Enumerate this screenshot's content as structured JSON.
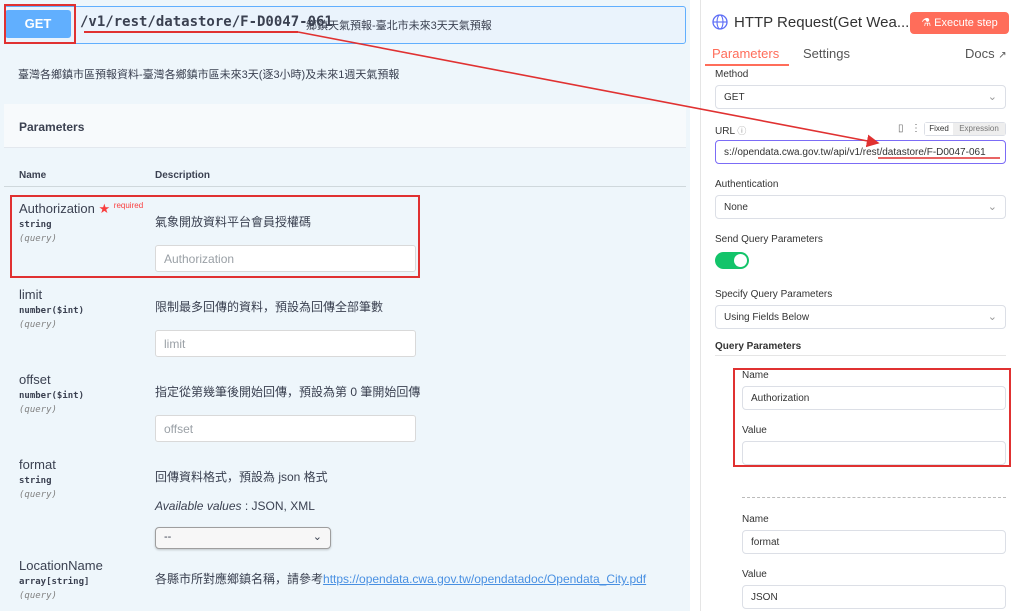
{
  "swagger": {
    "method": "GET",
    "path": "/v1/rest/datastore/F-D0047-061",
    "summary": "鄉鎮天氣預報-臺北市未來3天天氣預報",
    "description": "臺灣各鄉鎮市區預報資料-臺灣各鄉鎮市區未來3天(逐3小時)及未來1週天氣預報",
    "parameters_title": "Parameters",
    "col_name": "Name",
    "col_description": "Description",
    "params": [
      {
        "name": "Authorization",
        "required_mark": "★",
        "required_text": "required",
        "type": "string",
        "in": "(query)",
        "desc": "氣象開放資料平台會員授權碼",
        "placeholder": "Authorization"
      },
      {
        "name": "limit",
        "type": "number($int)",
        "in": "(query)",
        "desc": "限制最多回傳的資料，預設為回傳全部筆數",
        "placeholder": "limit"
      },
      {
        "name": "offset",
        "type": "number($int)",
        "in": "(query)",
        "desc": "指定從第幾筆後開始回傳，預設為第 0 筆開始回傳",
        "placeholder": "offset"
      },
      {
        "name": "format",
        "type": "string",
        "in": "(query)",
        "desc": "回傳資料格式，預設為 json 格式",
        "avail_label": "Available values",
        "avail_values": " : JSON, XML",
        "select_value": "--"
      },
      {
        "name": "LocationName",
        "type": "array[string]",
        "in": "(query)",
        "desc": "各縣市所對應鄉鎮名稱，請參考",
        "link": "https://opendata.cwa.gov.tw/opendatadoc/Opendata_City.pdf"
      }
    ]
  },
  "n8n": {
    "title": "HTTP Request(Get Wea...",
    "execute_label": "Execute step",
    "tabs": {
      "parameters": "Parameters",
      "settings": "Settings",
      "docs": "Docs"
    },
    "method_label": "Method",
    "method_value": "GET",
    "url_label": "URL",
    "url_mode_fixed": "Fixed",
    "url_mode_expression": "Expression",
    "url_value": "s://opendata.cwa.gov.tw/api/v1/rest/datastore/F-D0047-061",
    "auth_label": "Authentication",
    "auth_value": "None",
    "send_query_label": "Send Query Parameters",
    "send_query_on": true,
    "specify_label": "Specify Query Parameters",
    "specify_value": "Using Fields Below",
    "query_params_label": "Query Parameters",
    "query_params": [
      {
        "name_label": "Name",
        "name": "Authorization",
        "value_label": "Value",
        "value": ""
      },
      {
        "name_label": "Name",
        "name": "format",
        "value_label": "Value",
        "value": "JSON"
      }
    ]
  },
  "colors": {
    "accent": "#ff6d5a",
    "get": "#61affe",
    "annotation": "#e03131",
    "toggle_on": "#13c46a"
  }
}
